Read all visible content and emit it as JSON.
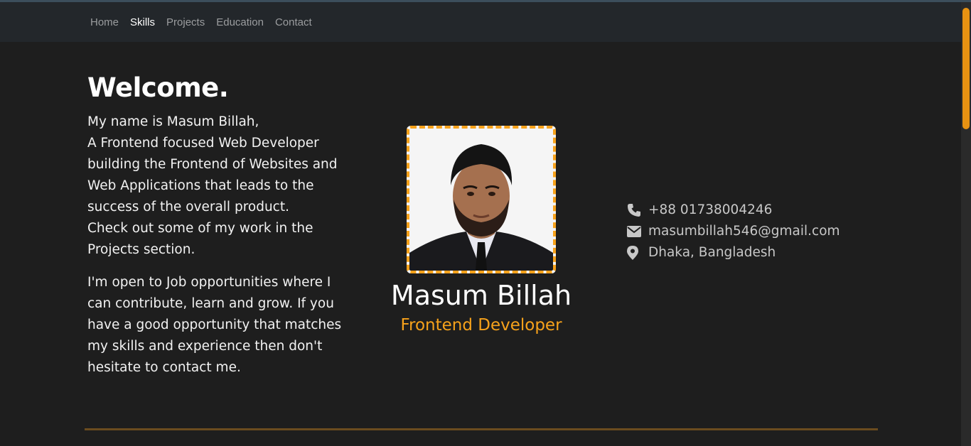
{
  "nav": {
    "items": [
      {
        "label": "Home",
        "active": false
      },
      {
        "label": "Skills",
        "active": true
      },
      {
        "label": "Projects",
        "active": false
      },
      {
        "label": "Education",
        "active": false
      },
      {
        "label": "Contact",
        "active": false
      }
    ]
  },
  "hero": {
    "welcome": "Welcome.",
    "intro_lines": [
      "My name is Masum Billah,",
      "A Frontend focused Web Developer",
      "building the Frontend of Websites and",
      "Web Applications that leads to the",
      "success of the overall product.",
      "Check out some of my work in the",
      "Projects section."
    ],
    "open_lines": [
      "I'm open to Job opportunities where I",
      "can contribute, learn and grow. If you",
      "have a good opportunity that matches",
      "my skills and experience then don't",
      "hesitate to contact me."
    ]
  },
  "profile": {
    "name": "Masum Billah",
    "role": "Frontend Developer",
    "photo_icon": "profile-photo"
  },
  "contact": {
    "phone": {
      "icon": "phone-icon",
      "text": "+88 01738004246"
    },
    "email": {
      "icon": "envelope-icon",
      "text": "masumbillah546@gmail.com"
    },
    "location": {
      "icon": "map-marker-icon",
      "text": "Dhaka, Bangladesh"
    }
  },
  "colors": {
    "accent": "#f7a21b",
    "background": "#1e1e1e",
    "navbar": "#23272b",
    "divider": "#6b4c1f"
  }
}
